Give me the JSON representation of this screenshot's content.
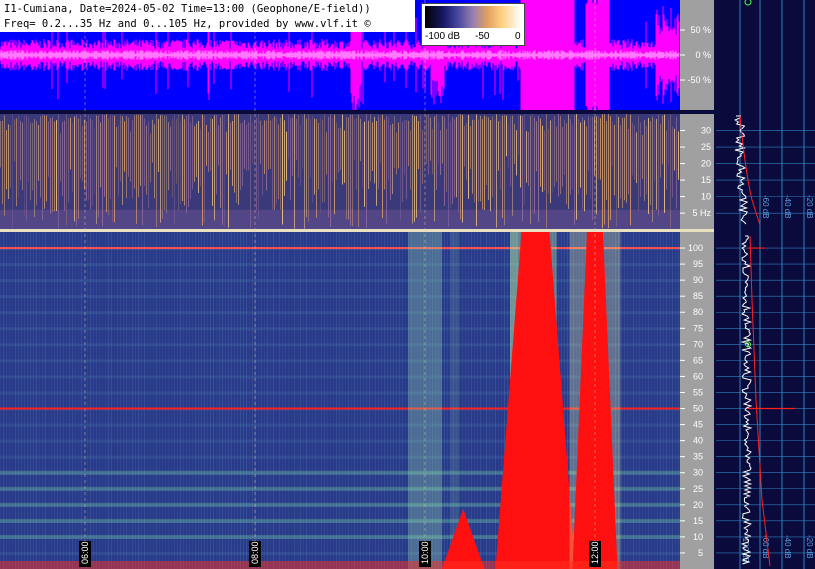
{
  "header": {
    "line1": "I1-Cumiana, Date=2024-05-02 Time=13:00 (Geophone/E-field))",
    "line2": "Freq= 0.2...35 Hz and 0...105 Hz, provided by www.vlf.it ©"
  },
  "colorbar": {
    "labels": [
      "-100 dB",
      "-50",
      "0"
    ]
  },
  "chart_data": [
    {
      "type": "area",
      "panel": "waveform",
      "yticks": [
        "50 %",
        "0 %",
        "-50 %"
      ],
      "yticks_values": [
        50,
        0,
        -50
      ],
      "ylim": [
        -100,
        100
      ],
      "colors": {
        "background": "#0000ff",
        "signal": "#ff00ff",
        "axis_bg": "#a0a0a0"
      }
    },
    {
      "type": "heatmap",
      "panel": "spectrogram-low",
      "ylabel_unit": "Hz",
      "yticks": [
        "30",
        "25",
        "20",
        "15",
        "10",
        "5 Hz"
      ],
      "yticks_values": [
        30,
        25,
        20,
        15,
        10,
        5
      ],
      "ylim": [
        0.2,
        35
      ]
    },
    {
      "type": "heatmap",
      "panel": "spectrogram-high",
      "yticks": [
        "100",
        "95",
        "90",
        "85",
        "80",
        "75",
        "70",
        "65",
        "60",
        "55",
        "50",
        "45",
        "40",
        "35",
        "30",
        "25",
        "20",
        "15",
        "10",
        "5"
      ],
      "yticks_values": [
        100,
        95,
        90,
        85,
        80,
        75,
        70,
        65,
        60,
        55,
        50,
        45,
        40,
        35,
        30,
        25,
        20,
        15,
        10,
        5
      ],
      "ylim": [
        0,
        105
      ],
      "xticks": [
        "06:00",
        "08:00",
        "10:00",
        "12:00"
      ],
      "xticks_hours": [
        6,
        8,
        10,
        12
      ],
      "xlim_hours": [
        5,
        13
      ],
      "colors": {
        "line_50hz": "#ff2020",
        "burst": "#ff1010"
      }
    },
    {
      "type": "line",
      "panel": "spectrum-side",
      "xticks_upper": [
        "-60 dB",
        "-40 dB",
        "-20 dB"
      ],
      "xticks_lower": [
        "-100 dB",
        "-60 dB",
        "-40 dB",
        "-20 dB"
      ],
      "colors": {
        "trace": "#ffffff",
        "fit": "#ff2020",
        "bg": "#0a0a3c",
        "grid": "#3080c0"
      }
    }
  ]
}
